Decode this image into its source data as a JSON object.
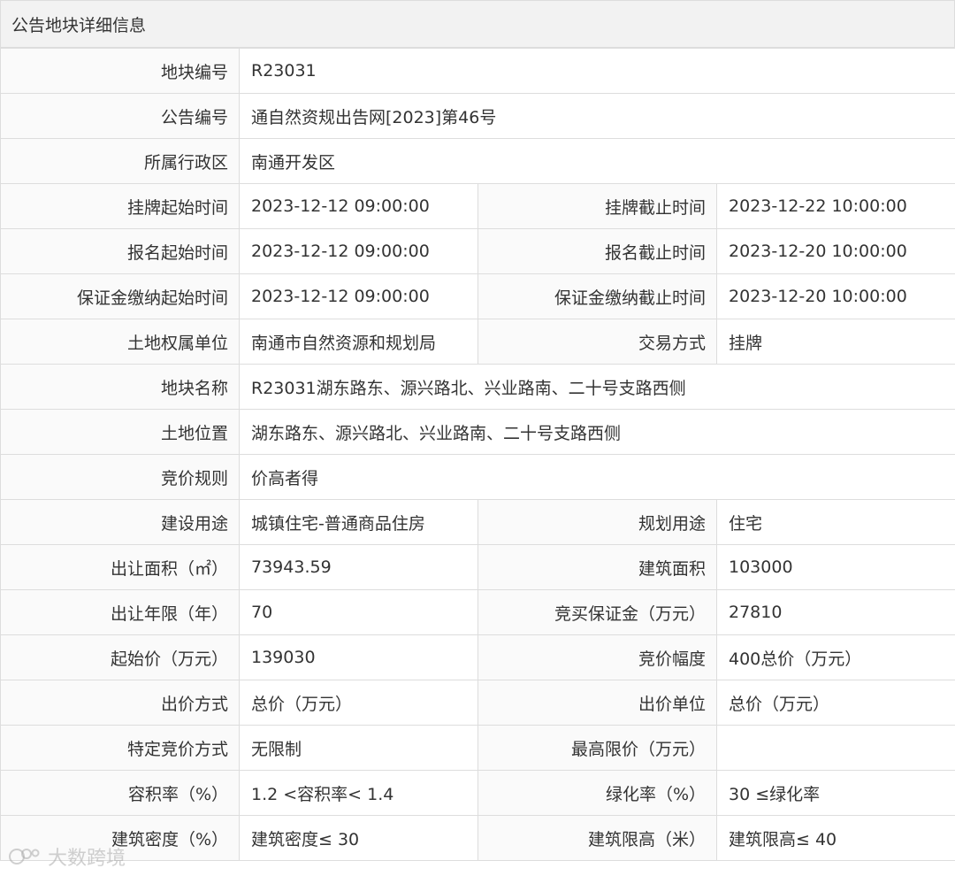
{
  "header": {
    "title": "公告地块详细信息"
  },
  "rows": [
    {
      "l1": "地块编号",
      "v1": "R23031"
    },
    {
      "l1": "公告编号",
      "v1": "通自然资规出告网[2023]第46号"
    },
    {
      "l1": "所属行政区",
      "v1": "南通开发区"
    },
    {
      "l1": "挂牌起始时间",
      "v1": "2023-12-12 09:00:00",
      "l2": "挂牌截止时间",
      "v2": "2023-12-22 10:00:00"
    },
    {
      "l1": "报名起始时间",
      "v1": "2023-12-12 09:00:00",
      "l2": "报名截止时间",
      "v2": "2023-12-20 10:00:00"
    },
    {
      "l1": "保证金缴纳起始时间",
      "v1": "2023-12-12 09:00:00",
      "l2": "保证金缴纳截止时间",
      "v2": "2023-12-20 10:00:00"
    },
    {
      "l1": "土地权属单位",
      "v1": "南通市自然资源和规划局",
      "l2": "交易方式",
      "v2": "挂牌"
    },
    {
      "l1": "地块名称",
      "v1": "R23031湖东路东、源兴路北、兴业路南、二十号支路西侧"
    },
    {
      "l1": "土地位置",
      "v1": "湖东路东、源兴路北、兴业路南、二十号支路西侧"
    },
    {
      "l1": "竞价规则",
      "v1": "价高者得"
    },
    {
      "l1": "建设用途",
      "v1": "城镇住宅-普通商品住房",
      "l2": "规划用途",
      "v2": "住宅"
    },
    {
      "l1": "出让面积（㎡）",
      "v1": "73943.59",
      "l2": "建筑面积",
      "v2": "103000"
    },
    {
      "l1": "出让年限（年）",
      "v1": "70",
      "l2": "竞买保证金（万元）",
      "v2": "27810"
    },
    {
      "l1": "起始价（万元）",
      "v1": "139030",
      "l2": "竞价幅度",
      "v2": "400总价（万元）"
    },
    {
      "l1": "出价方式",
      "v1": "总价（万元）",
      "l2": "出价单位",
      "v2": "总价（万元）"
    },
    {
      "l1": "特定竞价方式",
      "v1": "无限制",
      "l2": "最高限价（万元）",
      "v2": ""
    },
    {
      "l1": "容积率（%）",
      "v1": "1.2 <容积率< 1.4",
      "l2": "绿化率（%）",
      "v2": "30 ≤绿化率"
    },
    {
      "l1": "建筑密度（%）",
      "v1": "建筑密度≤ 30",
      "l2": "建筑限高（米）",
      "v2": "建筑限高≤ 40"
    }
  ],
  "watermark": {
    "text": "大数跨境"
  }
}
